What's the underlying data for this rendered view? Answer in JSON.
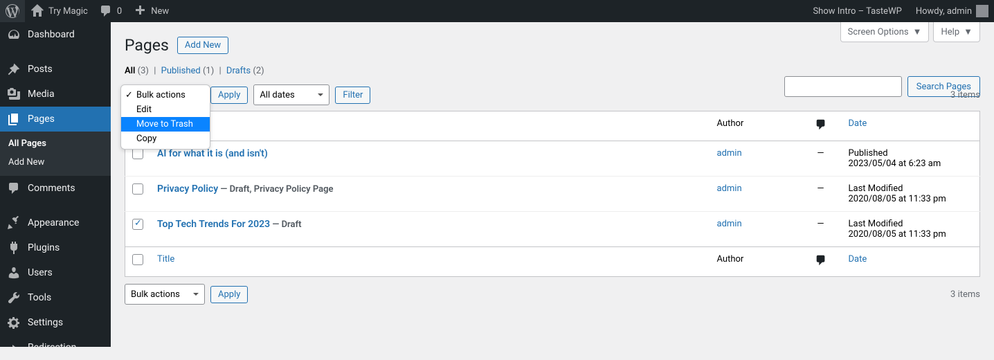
{
  "adminBar": {
    "tryMagic": "Try Magic",
    "commentCount": "0",
    "new": "New",
    "showIntro": "Show Intro – TasteWP",
    "howdy": "Howdy, admin"
  },
  "sidebar": {
    "dashboard": "Dashboard",
    "posts": "Posts",
    "media": "Media",
    "pages": "Pages",
    "allPages": "All Pages",
    "addNew": "Add New",
    "comments": "Comments",
    "appearance": "Appearance",
    "plugins": "Plugins",
    "users": "Users",
    "tools": "Tools",
    "settings": "Settings",
    "redirection": "Redirection"
  },
  "header": {
    "pageTitle": "Pages",
    "addNew": "Add New",
    "screenOptions": "Screen Options",
    "help": "Help"
  },
  "filters": {
    "allLabel": "All",
    "allCount": "(3)",
    "publishedLabel": "Published",
    "publishedCount": "(1)",
    "draftsLabel": "Drafts",
    "draftsCount": "(2)"
  },
  "search": {
    "buttonLabel": "Search Pages"
  },
  "bulkActions": {
    "label": "Bulk actions",
    "apply": "Apply",
    "options": {
      "bulk": "Bulk actions",
      "edit": "Edit",
      "trash": "Move to Trash",
      "copy": "Copy"
    }
  },
  "dateFilter": {
    "label": "All dates",
    "filterBtn": "Filter"
  },
  "itemsCount": "3 items",
  "columns": {
    "title": "Title",
    "author": "Author",
    "date": "Date"
  },
  "rows": [
    {
      "titlePrefix": "AI for what it is (and isn't)",
      "state": "",
      "author": "admin",
      "comments": "—",
      "dateLabel": "Published",
      "dateValue": "2023/05/04 at 6:23 am",
      "checked": false
    },
    {
      "titlePrefix": "Privacy Policy",
      "state": " — Draft, Privacy Policy Page",
      "author": "admin",
      "comments": "—",
      "dateLabel": "Last Modified",
      "dateValue": "2020/08/05 at 11:33 pm",
      "checked": false
    },
    {
      "titlePrefix": "Top Tech Trends For 2023",
      "state": " — Draft",
      "author": "admin",
      "comments": "—",
      "dateLabel": "Last Modified",
      "dateValue": "2020/08/05 at 11:33 pm",
      "checked": true
    }
  ]
}
